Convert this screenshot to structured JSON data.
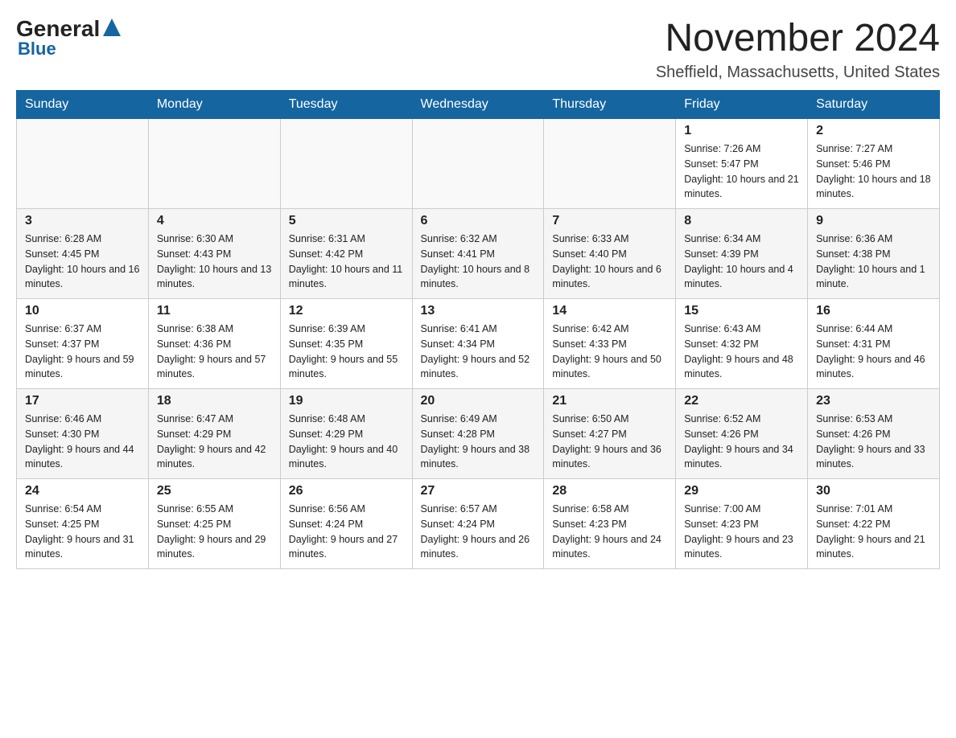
{
  "logo": {
    "general": "General",
    "blue": "Blue",
    "tagline": "Blue"
  },
  "title": {
    "month": "November 2024",
    "location": "Sheffield, Massachusetts, United States"
  },
  "headers": [
    "Sunday",
    "Monday",
    "Tuesday",
    "Wednesday",
    "Thursday",
    "Friday",
    "Saturday"
  ],
  "rows": [
    [
      {
        "day": "",
        "sunrise": "",
        "sunset": "",
        "daylight": ""
      },
      {
        "day": "",
        "sunrise": "",
        "sunset": "",
        "daylight": ""
      },
      {
        "day": "",
        "sunrise": "",
        "sunset": "",
        "daylight": ""
      },
      {
        "day": "",
        "sunrise": "",
        "sunset": "",
        "daylight": ""
      },
      {
        "day": "",
        "sunrise": "",
        "sunset": "",
        "daylight": ""
      },
      {
        "day": "1",
        "sunrise": "Sunrise: 7:26 AM",
        "sunset": "Sunset: 5:47 PM",
        "daylight": "Daylight: 10 hours and 21 minutes."
      },
      {
        "day": "2",
        "sunrise": "Sunrise: 7:27 AM",
        "sunset": "Sunset: 5:46 PM",
        "daylight": "Daylight: 10 hours and 18 minutes."
      }
    ],
    [
      {
        "day": "3",
        "sunrise": "Sunrise: 6:28 AM",
        "sunset": "Sunset: 4:45 PM",
        "daylight": "Daylight: 10 hours and 16 minutes."
      },
      {
        "day": "4",
        "sunrise": "Sunrise: 6:30 AM",
        "sunset": "Sunset: 4:43 PM",
        "daylight": "Daylight: 10 hours and 13 minutes."
      },
      {
        "day": "5",
        "sunrise": "Sunrise: 6:31 AM",
        "sunset": "Sunset: 4:42 PM",
        "daylight": "Daylight: 10 hours and 11 minutes."
      },
      {
        "day": "6",
        "sunrise": "Sunrise: 6:32 AM",
        "sunset": "Sunset: 4:41 PM",
        "daylight": "Daylight: 10 hours and 8 minutes."
      },
      {
        "day": "7",
        "sunrise": "Sunrise: 6:33 AM",
        "sunset": "Sunset: 4:40 PM",
        "daylight": "Daylight: 10 hours and 6 minutes."
      },
      {
        "day": "8",
        "sunrise": "Sunrise: 6:34 AM",
        "sunset": "Sunset: 4:39 PM",
        "daylight": "Daylight: 10 hours and 4 minutes."
      },
      {
        "day": "9",
        "sunrise": "Sunrise: 6:36 AM",
        "sunset": "Sunset: 4:38 PM",
        "daylight": "Daylight: 10 hours and 1 minute."
      }
    ],
    [
      {
        "day": "10",
        "sunrise": "Sunrise: 6:37 AM",
        "sunset": "Sunset: 4:37 PM",
        "daylight": "Daylight: 9 hours and 59 minutes."
      },
      {
        "day": "11",
        "sunrise": "Sunrise: 6:38 AM",
        "sunset": "Sunset: 4:36 PM",
        "daylight": "Daylight: 9 hours and 57 minutes."
      },
      {
        "day": "12",
        "sunrise": "Sunrise: 6:39 AM",
        "sunset": "Sunset: 4:35 PM",
        "daylight": "Daylight: 9 hours and 55 minutes."
      },
      {
        "day": "13",
        "sunrise": "Sunrise: 6:41 AM",
        "sunset": "Sunset: 4:34 PM",
        "daylight": "Daylight: 9 hours and 52 minutes."
      },
      {
        "day": "14",
        "sunrise": "Sunrise: 6:42 AM",
        "sunset": "Sunset: 4:33 PM",
        "daylight": "Daylight: 9 hours and 50 minutes."
      },
      {
        "day": "15",
        "sunrise": "Sunrise: 6:43 AM",
        "sunset": "Sunset: 4:32 PM",
        "daylight": "Daylight: 9 hours and 48 minutes."
      },
      {
        "day": "16",
        "sunrise": "Sunrise: 6:44 AM",
        "sunset": "Sunset: 4:31 PM",
        "daylight": "Daylight: 9 hours and 46 minutes."
      }
    ],
    [
      {
        "day": "17",
        "sunrise": "Sunrise: 6:46 AM",
        "sunset": "Sunset: 4:30 PM",
        "daylight": "Daylight: 9 hours and 44 minutes."
      },
      {
        "day": "18",
        "sunrise": "Sunrise: 6:47 AM",
        "sunset": "Sunset: 4:29 PM",
        "daylight": "Daylight: 9 hours and 42 minutes."
      },
      {
        "day": "19",
        "sunrise": "Sunrise: 6:48 AM",
        "sunset": "Sunset: 4:29 PM",
        "daylight": "Daylight: 9 hours and 40 minutes."
      },
      {
        "day": "20",
        "sunrise": "Sunrise: 6:49 AM",
        "sunset": "Sunset: 4:28 PM",
        "daylight": "Daylight: 9 hours and 38 minutes."
      },
      {
        "day": "21",
        "sunrise": "Sunrise: 6:50 AM",
        "sunset": "Sunset: 4:27 PM",
        "daylight": "Daylight: 9 hours and 36 minutes."
      },
      {
        "day": "22",
        "sunrise": "Sunrise: 6:52 AM",
        "sunset": "Sunset: 4:26 PM",
        "daylight": "Daylight: 9 hours and 34 minutes."
      },
      {
        "day": "23",
        "sunrise": "Sunrise: 6:53 AM",
        "sunset": "Sunset: 4:26 PM",
        "daylight": "Daylight: 9 hours and 33 minutes."
      }
    ],
    [
      {
        "day": "24",
        "sunrise": "Sunrise: 6:54 AM",
        "sunset": "Sunset: 4:25 PM",
        "daylight": "Daylight: 9 hours and 31 minutes."
      },
      {
        "day": "25",
        "sunrise": "Sunrise: 6:55 AM",
        "sunset": "Sunset: 4:25 PM",
        "daylight": "Daylight: 9 hours and 29 minutes."
      },
      {
        "day": "26",
        "sunrise": "Sunrise: 6:56 AM",
        "sunset": "Sunset: 4:24 PM",
        "daylight": "Daylight: 9 hours and 27 minutes."
      },
      {
        "day": "27",
        "sunrise": "Sunrise: 6:57 AM",
        "sunset": "Sunset: 4:24 PM",
        "daylight": "Daylight: 9 hours and 26 minutes."
      },
      {
        "day": "28",
        "sunrise": "Sunrise: 6:58 AM",
        "sunset": "Sunset: 4:23 PM",
        "daylight": "Daylight: 9 hours and 24 minutes."
      },
      {
        "day": "29",
        "sunrise": "Sunrise: 7:00 AM",
        "sunset": "Sunset: 4:23 PM",
        "daylight": "Daylight: 9 hours and 23 minutes."
      },
      {
        "day": "30",
        "sunrise": "Sunrise: 7:01 AM",
        "sunset": "Sunset: 4:22 PM",
        "daylight": "Daylight: 9 hours and 21 minutes."
      }
    ]
  ]
}
